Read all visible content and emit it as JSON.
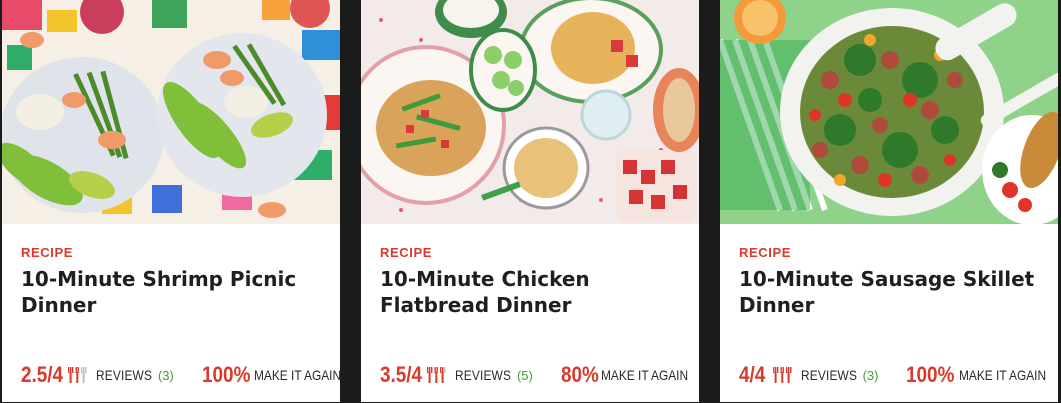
{
  "cards": [
    {
      "tag": "RECIPE",
      "title": "10-Minute Shrimp Picnic Dinner",
      "rating": "2.5/4",
      "reviews_label": "REVIEWS",
      "reviews_count": "(3)",
      "make_again_pct": "100%",
      "make_again_label": "MAKE IT AGAIN",
      "image_alt": "shrimp-picnic-photo"
    },
    {
      "tag": "RECIPE",
      "title": "10-Minute Chicken Flatbread Dinner",
      "rating": "3.5/4",
      "reviews_label": "REVIEWS",
      "reviews_count": "(5)",
      "make_again_pct": "80%",
      "make_again_label": "MAKE IT AGAIN",
      "image_alt": "chicken-flatbread-photo"
    },
    {
      "tag": "RECIPE",
      "title": "10-Minute Sausage Skillet Dinner",
      "rating": "4/4",
      "reviews_label": "REVIEWS",
      "reviews_count": "(3)",
      "make_again_pct": "100%",
      "make_again_label": "MAKE IT AGAIN",
      "image_alt": "sausage-skillet-photo"
    }
  ],
  "colors": {
    "accent": "#d83a2b",
    "count_green": "#4a9a3a",
    "background": "#1b1b1b"
  },
  "icons": {
    "rating": "fork-rating-icon"
  }
}
